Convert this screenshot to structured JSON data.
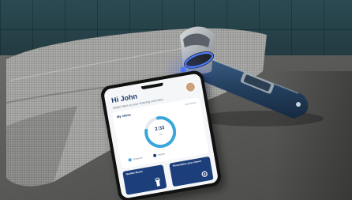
{
  "phone_screen": {
    "greeting": "Hi John",
    "subline": "Hello! Here is your shaving overview",
    "card_title": "My shave",
    "card_note": "Last shave",
    "ring_value": "2:33",
    "ring_unit": "min",
    "legend": [
      "Pressure",
      "Motion"
    ],
    "tiles": [
      {
        "label": "Guided Shave"
      },
      {
        "label": "Personalise your shaver"
      }
    ]
  },
  "colors": {
    "brand_blue": "#1c3e7a",
    "ring_accent": "#3aa6d9",
    "shaver_light": "#3b6bff"
  },
  "icons": [
    "shaver-icon",
    "settings-icon"
  ]
}
